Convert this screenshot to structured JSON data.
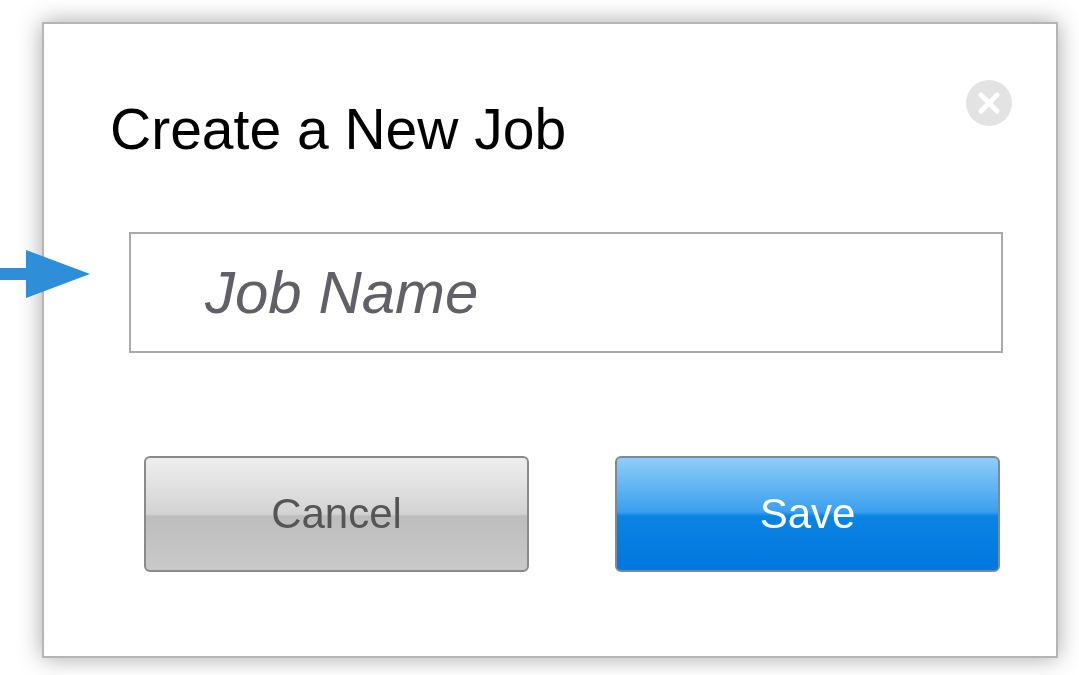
{
  "dialog": {
    "title": "Create a New Job",
    "job_name": {
      "placeholder": "Job Name"
    },
    "buttons": [
      {
        "label": "Cancel",
        "kind": "secondary"
      },
      {
        "label": "Save",
        "kind": "primary"
      }
    ]
  }
}
